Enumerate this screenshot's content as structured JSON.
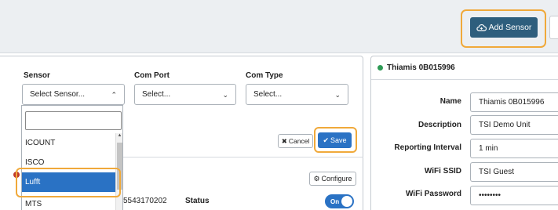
{
  "header": {
    "add_sensor_label": "Add Sensor"
  },
  "config": {
    "sensor_label": "Sensor",
    "comport_label": "Com Port",
    "comtype_label": "Com Type",
    "sensor_placeholder": "Select Sensor...",
    "comport_placeholder": "Select...",
    "comtype_placeholder": "Select...",
    "dropdown": {
      "search_value": "",
      "items": [
        "ICOUNT",
        "ISCO",
        "Lufft",
        "MTS"
      ],
      "selected": "Lufft"
    },
    "cancel_label": "Cancel",
    "save_label": "Save"
  },
  "sensor_row": {
    "configure_label": "Configure",
    "id_partial": "5543170202",
    "status_label": "Status",
    "toggle_label": "On"
  },
  "device": {
    "title": "Thiamis 0B015996",
    "status_color": "#2e9a55",
    "fields": [
      {
        "label": "Name",
        "value": "Thiamis 0B015996"
      },
      {
        "label": "Description",
        "value": "TSI Demo Unit"
      },
      {
        "label": "Reporting Interval",
        "value": "1 min"
      },
      {
        "label": "WiFi SSID",
        "value": "TSI Guest"
      },
      {
        "label": "WiFi Password",
        "value": "••••••••"
      }
    ]
  },
  "colors": {
    "accent": "#2a72c4",
    "header_button": "#2e5e7d",
    "highlight": "#f0a93a"
  }
}
